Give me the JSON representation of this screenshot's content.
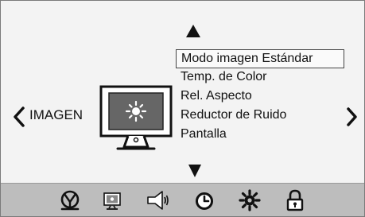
{
  "section": {
    "title": "IMAGEN"
  },
  "menu": {
    "items": [
      {
        "label": "Modo imagen Estándar",
        "selected": true
      },
      {
        "label": "Temp. de Color",
        "selected": false
      },
      {
        "label": "Rel. Aspecto",
        "selected": false
      },
      {
        "label": "Reductor de Ruido",
        "selected": false
      },
      {
        "label": "Pantalla",
        "selected": false
      }
    ]
  },
  "tabs": [
    {
      "icon": "channel-icon"
    },
    {
      "icon": "picture-icon"
    },
    {
      "icon": "sound-icon"
    },
    {
      "icon": "time-icon"
    },
    {
      "icon": "setup-icon"
    },
    {
      "icon": "lock-icon"
    }
  ],
  "colors": {
    "background": "#f3f3f3",
    "bottom_bar": "#bdbdbd",
    "text": "#111111",
    "selection_border": "#444444"
  }
}
